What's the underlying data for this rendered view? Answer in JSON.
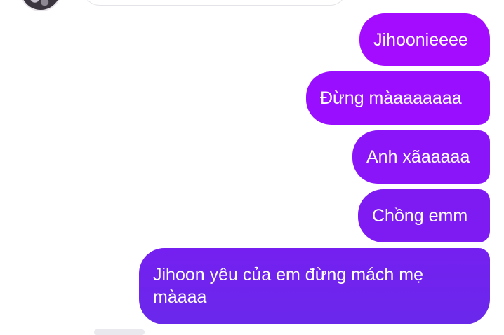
{
  "conversation": {
    "messages": [
      {
        "sender": "me",
        "text": "Jihoonieeee"
      },
      {
        "sender": "me",
        "text": "Đừng màaaaaaaa"
      },
      {
        "sender": "me",
        "text": "Anh xãaaaaa"
      },
      {
        "sender": "me",
        "text": "Chồng emm"
      },
      {
        "sender": "me",
        "text": "Jihoon yêu của em đừng mách mẹ màaaa"
      }
    ]
  },
  "colors": {
    "bubble_top": "#a30cff",
    "bubble_bottom": "#6a28eb",
    "background": "#ffffff"
  }
}
